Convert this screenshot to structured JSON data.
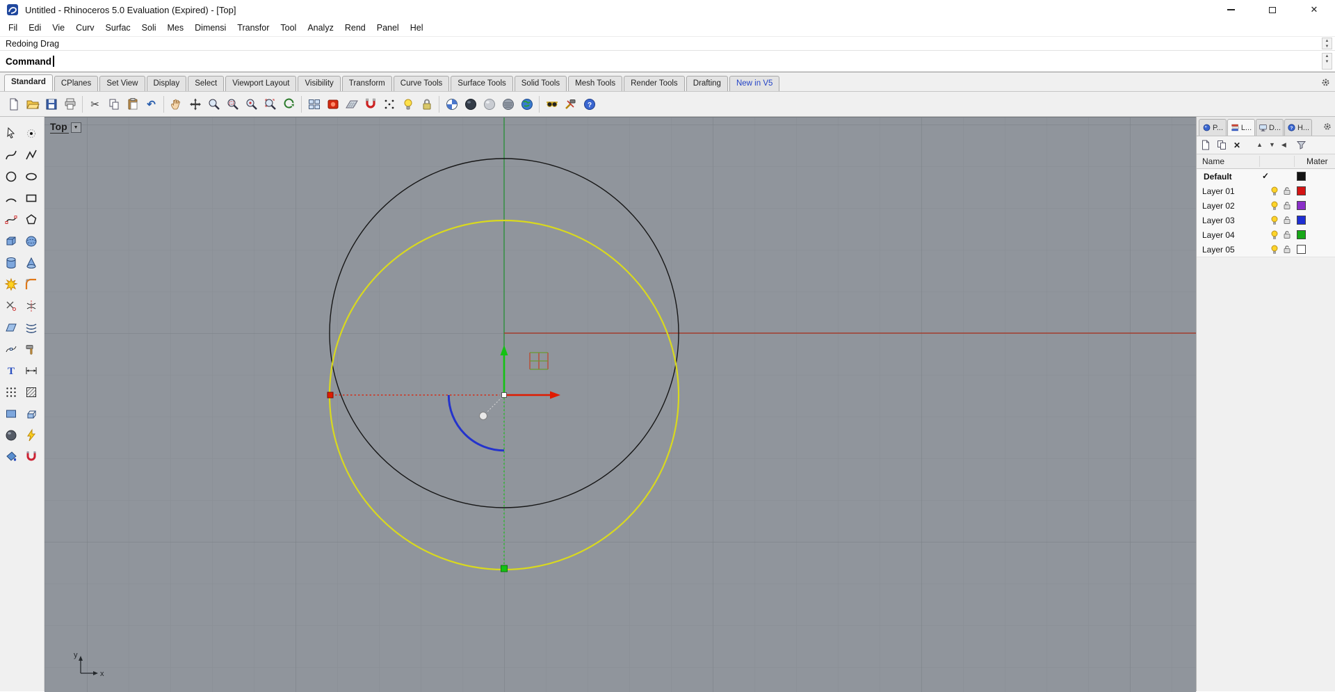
{
  "window": {
    "title": "Untitled - Rhinoceros 5.0 Evaluation (Expired) - [Top]",
    "controls": [
      "minimize",
      "maximize",
      "close"
    ]
  },
  "menubar": {
    "items": [
      "Fil",
      "Edi",
      "Vie",
      "Curv",
      "Surfac",
      "Soli",
      "Mes",
      "Dimensi",
      "Transfor",
      "Tool",
      "Analyz",
      "Rend",
      "Panel",
      "Hel"
    ]
  },
  "command": {
    "history_line": "Redoing Drag",
    "prompt_label": "Command",
    "input_value": ""
  },
  "toolbar_tabs": {
    "active": "Standard",
    "items": [
      "Standard",
      "CPlanes",
      "Set View",
      "Display",
      "Select",
      "Viewport Layout",
      "Visibility",
      "Transform",
      "Curve Tools",
      "Surface Tools",
      "Solid Tools",
      "Mesh Tools",
      "Render Tools",
      "Drafting",
      "New in V5"
    ]
  },
  "main_toolbar": {
    "icons": [
      "new-file",
      "open-file",
      "save",
      "print",
      "cut",
      "copy",
      "paste",
      "undo",
      "pan",
      "move",
      "zoom-dynamic",
      "zoom-window",
      "zoom-selected",
      "zoom-extents",
      "rotate-view",
      "viewport-layout",
      "render",
      "cplane",
      "object-snap",
      "points-on",
      "lightbulb",
      "lock",
      "shaded-view",
      "wireframe-view",
      "ghosted-view",
      "xray-view",
      "rendered-view",
      "sunglasses",
      "toolbox",
      "help"
    ]
  },
  "left_toolbar": {
    "icons": [
      "select",
      "point",
      "curve",
      "polyline",
      "circle",
      "ellipse",
      "arc",
      "rectangle",
      "freeform",
      "polygon",
      "box",
      "sphere",
      "cylinder",
      "cone",
      "explode",
      "fillet",
      "trim",
      "split",
      "surface",
      "loft",
      "edit-point",
      "rebuild",
      "text",
      "dimension",
      "point-grid",
      "hatch",
      "planar-surface",
      "extrude",
      "render-sphere",
      "lightning",
      "paint",
      "magnet"
    ]
  },
  "viewport": {
    "label": "Top",
    "axis": {
      "x_label": "x",
      "y_label": "y"
    },
    "colors": {
      "background": "#90959c",
      "grid_minor": "#888d93",
      "grid_major": "#797e84",
      "curve": "#161616",
      "selected_curve": "#d9d91e",
      "x_axis": "#a23d2c",
      "y_axis": "#2c8f3c",
      "gumball_x": "#e01b00",
      "gumball_y": "#14c214",
      "arc_preview": "#2433cc"
    }
  },
  "layers_panel": {
    "tabs": [
      {
        "label": "P...",
        "icon": "properties-icon"
      },
      {
        "label": "L...",
        "icon": "layers-icon"
      },
      {
        "label": "D...",
        "icon": "display-icon"
      },
      {
        "label": "H...",
        "icon": "help-icon"
      }
    ],
    "active_tab": "L...",
    "toolbar_icons": [
      "new-layer",
      "new-sublayer",
      "delete-layer",
      "move-up",
      "move-down",
      "collapse",
      "filter"
    ],
    "columns": [
      "Name",
      "Mater"
    ],
    "rows": [
      {
        "name": "Default",
        "current": "✓",
        "color": "#141414"
      },
      {
        "name": "Layer 01",
        "color": "#d41414"
      },
      {
        "name": "Layer 02",
        "color": "#8a2fc8"
      },
      {
        "name": "Layer 03",
        "color": "#1f2fd4"
      },
      {
        "name": "Layer 04",
        "color": "#18a818"
      },
      {
        "name": "Layer 05",
        "color": "#ffffff"
      }
    ]
  },
  "glyphs": {
    "cut": "✂",
    "undo": "↶",
    "dropdown": "▼",
    "up_arrow": "▲",
    "down_arrow": "▼",
    "left_arrow": "◀",
    "close": "✕",
    "delete_x": "✕",
    "question": "?"
  }
}
